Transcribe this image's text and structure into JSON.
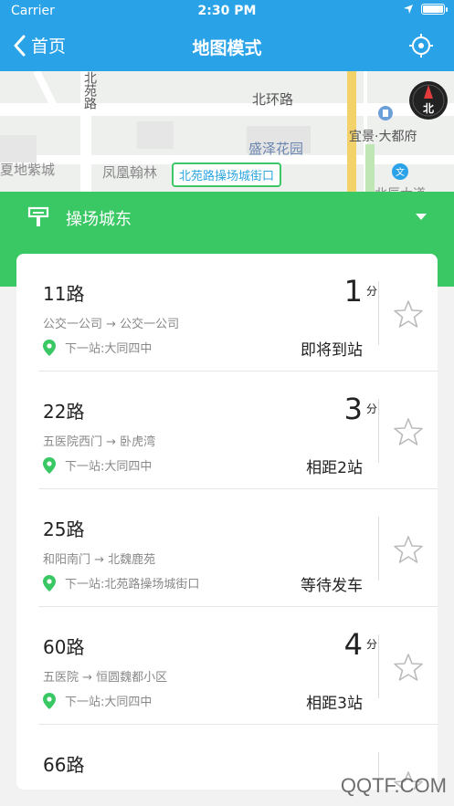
{
  "status_bar": {
    "carrier": "Carrier",
    "time": "2:30 PM"
  },
  "nav": {
    "back_label": "首页",
    "title": "地图模式"
  },
  "map": {
    "labels": {
      "road_north": "北环路",
      "road_west": "北苑路",
      "area_1": "盛泽花园",
      "poi_1": "宜景·大都府",
      "area_2": "夏地紫城",
      "area_3": "凤凰翰林",
      "road_bottom": "北辰大道"
    },
    "compass_label": "北",
    "stop_tag": "北苑路操场城街口"
  },
  "station": {
    "name": "操场城东"
  },
  "routes": [
    {
      "name": "11路",
      "direction": "公交一公司 → 公交一公司",
      "next_stop": "下一站:大同四中",
      "minutes": "1",
      "unit": "分",
      "status": "即将到站"
    },
    {
      "name": "22路",
      "direction": "五医院西门 → 卧虎湾",
      "next_stop": "下一站:大同四中",
      "minutes": "3",
      "unit": "分",
      "status": "相距2站"
    },
    {
      "name": "25路",
      "direction": "和阳南门 → 北魏鹿苑",
      "next_stop": "下一站:北苑路操场城街口",
      "minutes": "",
      "unit": "",
      "status": "等待发车"
    },
    {
      "name": "60路",
      "direction": "五医院 → 恒圆魏都小区",
      "next_stop": "下一站:大同四中",
      "minutes": "4",
      "unit": "分",
      "status": "相距3站"
    },
    {
      "name": "66路",
      "direction": "",
      "next_stop": "",
      "minutes": "",
      "unit": "",
      "status": ""
    }
  ],
  "watermark": "QQTF.COM",
  "colors": {
    "nav_blue": "#2aa2e8",
    "accent_green": "#39c863"
  }
}
